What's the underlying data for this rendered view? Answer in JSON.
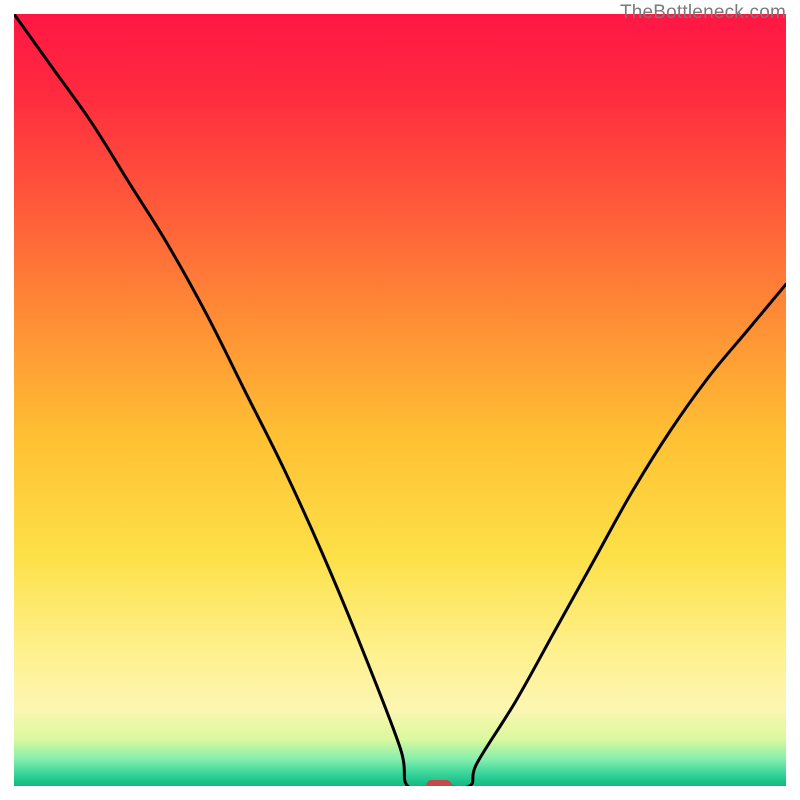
{
  "watermark": "TheBottleneck.com",
  "chart_data": {
    "type": "line",
    "title": "",
    "xlabel": "",
    "ylabel": "",
    "xlim": [
      0,
      100
    ],
    "ylim": [
      0,
      100
    ],
    "series": [
      {
        "name": "bottleneck-curve",
        "x": [
          0,
          5,
          10,
          15,
          20,
          25,
          30,
          35,
          40,
          45,
          50,
          51,
          55,
          59,
          60,
          65,
          70,
          75,
          80,
          85,
          90,
          95,
          100
        ],
        "values": [
          100,
          93,
          86,
          78,
          70,
          61,
          51,
          41,
          30,
          18,
          5,
          0,
          0,
          0,
          3,
          11,
          20,
          29,
          38,
          46,
          53,
          59,
          65
        ]
      }
    ],
    "marker": {
      "x": 55,
      "y": 0,
      "color": "#c14a4a"
    },
    "gradient_stops": [
      {
        "offset": 0.0,
        "color": "#ff1744"
      },
      {
        "offset": 0.1,
        "color": "#ff2a3f"
      },
      {
        "offset": 0.25,
        "color": "#ff5a3a"
      },
      {
        "offset": 0.4,
        "color": "#ff8f35"
      },
      {
        "offset": 0.55,
        "color": "#ffc133"
      },
      {
        "offset": 0.7,
        "color": "#fde047"
      },
      {
        "offset": 0.82,
        "color": "#fef08a"
      },
      {
        "offset": 0.9,
        "color": "#fdf6b2"
      },
      {
        "offset": 0.94,
        "color": "#d9f99d"
      },
      {
        "offset": 0.965,
        "color": "#86efac"
      },
      {
        "offset": 0.985,
        "color": "#34d399"
      },
      {
        "offset": 1.0,
        "color": "#10b981"
      }
    ]
  }
}
